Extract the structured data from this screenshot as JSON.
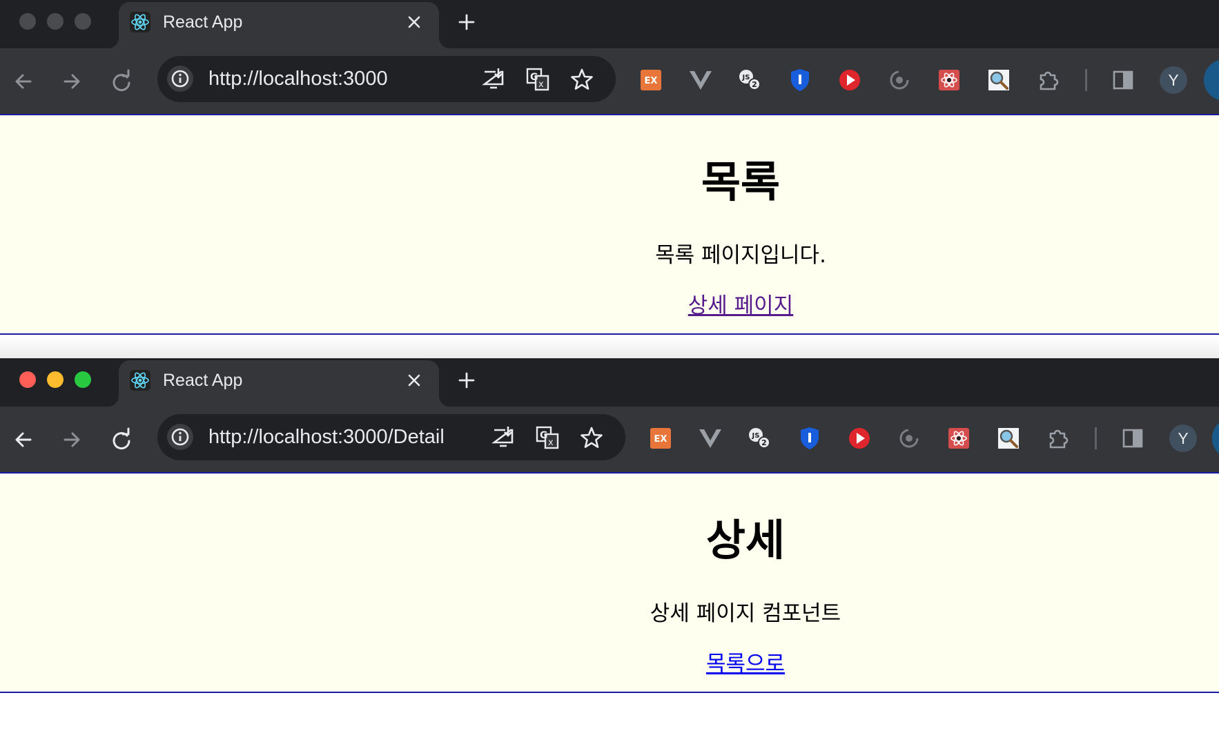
{
  "colors": {
    "tab_bar": "#202124",
    "toolbar": "#35363a",
    "page_bg": "#fffff0",
    "link_visited": "#551a8b",
    "link": "#0000ee",
    "light_red": "#ff5f57",
    "light_yellow": "#febc2e",
    "light_green": "#28c840",
    "light_inactive": "#4a4b4f"
  },
  "window1": {
    "tab": {
      "title": "React App",
      "favicon": "react-icon",
      "close_icon": "close-icon"
    },
    "new_tab_icon": "plus-icon",
    "url": "http://localhost:3000",
    "avatar_letter": "Y",
    "page": {
      "heading": "목록",
      "text": "목록 페이지입니다.",
      "link": "상세 페이지"
    }
  },
  "window2": {
    "tab": {
      "title": "React App",
      "favicon": "react-icon",
      "close_icon": "close-icon"
    },
    "new_tab_icon": "plus-icon",
    "url": "http://localhost:3000/Detail",
    "avatar_letter": "Y",
    "page": {
      "heading": "상세",
      "text": "상세 페이지 컴포넌트",
      "link": "목록으로"
    }
  },
  "toolbar_icons": [
    "back-icon",
    "forward-icon",
    "reload-icon",
    "site-info-icon",
    "install-app-icon",
    "translate-icon",
    "bookmark-star-icon"
  ],
  "extensions": [
    "ex-extension-icon",
    "vue-devtools-icon",
    "js2-extension-icon",
    "bitwarden-icon",
    "video-player-icon",
    "sync-icon",
    "react-devtools-icon",
    "magnifier-icon",
    "extensions-puzzle-icon",
    "side-panel-icon"
  ]
}
